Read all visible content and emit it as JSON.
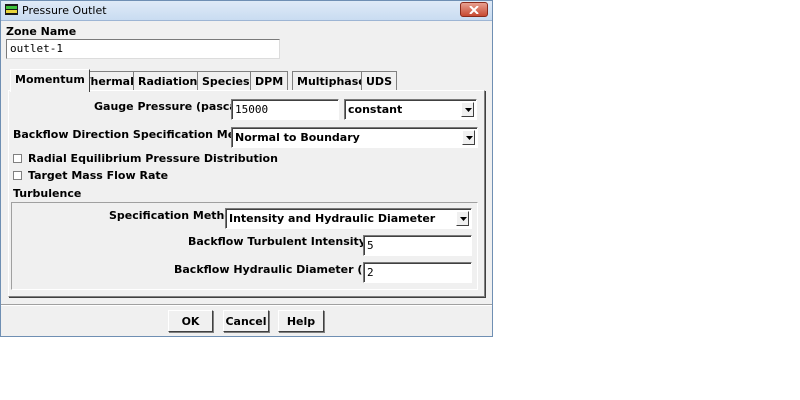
{
  "window": {
    "title": "Pressure Outlet",
    "icon": "app-icon",
    "close_icon": "close-icon"
  },
  "zone": {
    "label": "Zone Name",
    "value": "outlet-1"
  },
  "tabs": [
    {
      "label": "Momentum",
      "active": true
    },
    {
      "label": "Thermal"
    },
    {
      "label": "Radiation"
    },
    {
      "label": "Species"
    },
    {
      "label": "DPM"
    },
    {
      "label": "Multiphase"
    },
    {
      "label": "UDS"
    }
  ],
  "momentum": {
    "gauge_pressure_label": "Gauge Pressure (pascal)",
    "gauge_pressure_value": "15000",
    "gauge_pressure_method": "constant",
    "backflow_dir_label": "Backflow Direction Specification Method",
    "backflow_dir_value": "Normal to Boundary",
    "radial_eq_label": "Radial Equilibrium Pressure Distribution",
    "radial_eq_checked": false,
    "target_mass_label": "Target Mass Flow Rate",
    "target_mass_checked": false
  },
  "turbulence": {
    "heading": "Turbulence",
    "spec_method_label": "Specification Method",
    "spec_method_value": "Intensity and Hydraulic Diameter",
    "intensity_label": "Backflow Turbulent Intensity (%)",
    "intensity_value": "5",
    "diameter_label": "Backflow Hydraulic Diameter (mm)",
    "diameter_value": "2"
  },
  "buttons": {
    "ok": "OK",
    "cancel": "Cancel",
    "help": "Help"
  }
}
